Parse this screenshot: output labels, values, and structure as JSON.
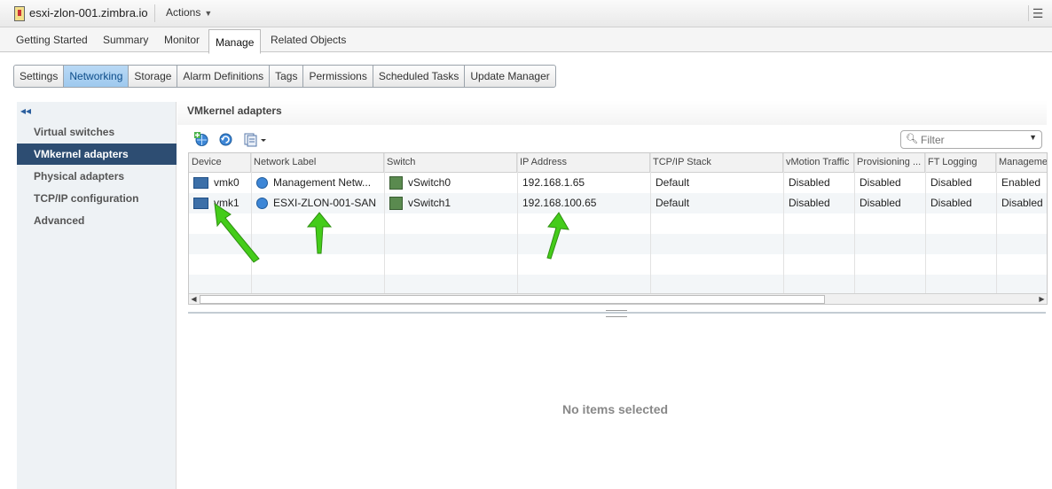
{
  "window": {
    "host_name": "esxi-zlon-001.zimbra.io",
    "actions_label": "Actions"
  },
  "main_tabs": [
    "Getting Started",
    "Summary",
    "Monitor",
    "Manage",
    "Related Objects"
  ],
  "sub_tabs": [
    "Settings",
    "Networking",
    "Storage",
    "Alarm Definitions",
    "Tags",
    "Permissions",
    "Scheduled Tasks",
    "Update Manager"
  ],
  "sidebar": {
    "items": [
      "Virtual switches",
      "VMkernel adapters",
      "Physical adapters",
      "TCP/IP configuration",
      "Advanced"
    ]
  },
  "content": {
    "title": "VMkernel adapters",
    "filter_placeholder": "Filter",
    "no_items": "No items selected"
  },
  "table": {
    "columns": [
      "Device",
      "Network Label",
      "Switch",
      "IP Address",
      "TCP/IP Stack",
      "vMotion Traffic",
      "Provisioning ...",
      "FT Logging",
      "Manageme"
    ],
    "rows": [
      [
        "vmk0",
        "Management Netw...",
        "vSwitch0",
        "192.168.1.65",
        "Default",
        "Disabled",
        "Disabled",
        "Disabled",
        "Enabled"
      ],
      [
        "vmk1",
        "ESXI-ZLON-001-SAN",
        "vSwitch1",
        "192.168.100.65",
        "Default",
        "Disabled",
        "Disabled",
        "Disabled",
        "Disabled"
      ]
    ]
  },
  "icons": [
    "host-icon",
    "add-networking-icon",
    "refresh-icon",
    "more-actions-icon",
    "search-icon",
    "nic-icon",
    "network-icon",
    "switch-icon"
  ],
  "colors": {
    "selected_nav": "#2d4d72",
    "active_subtab": "#9ec9ee",
    "annotation_arrow": "#44cc1a"
  }
}
